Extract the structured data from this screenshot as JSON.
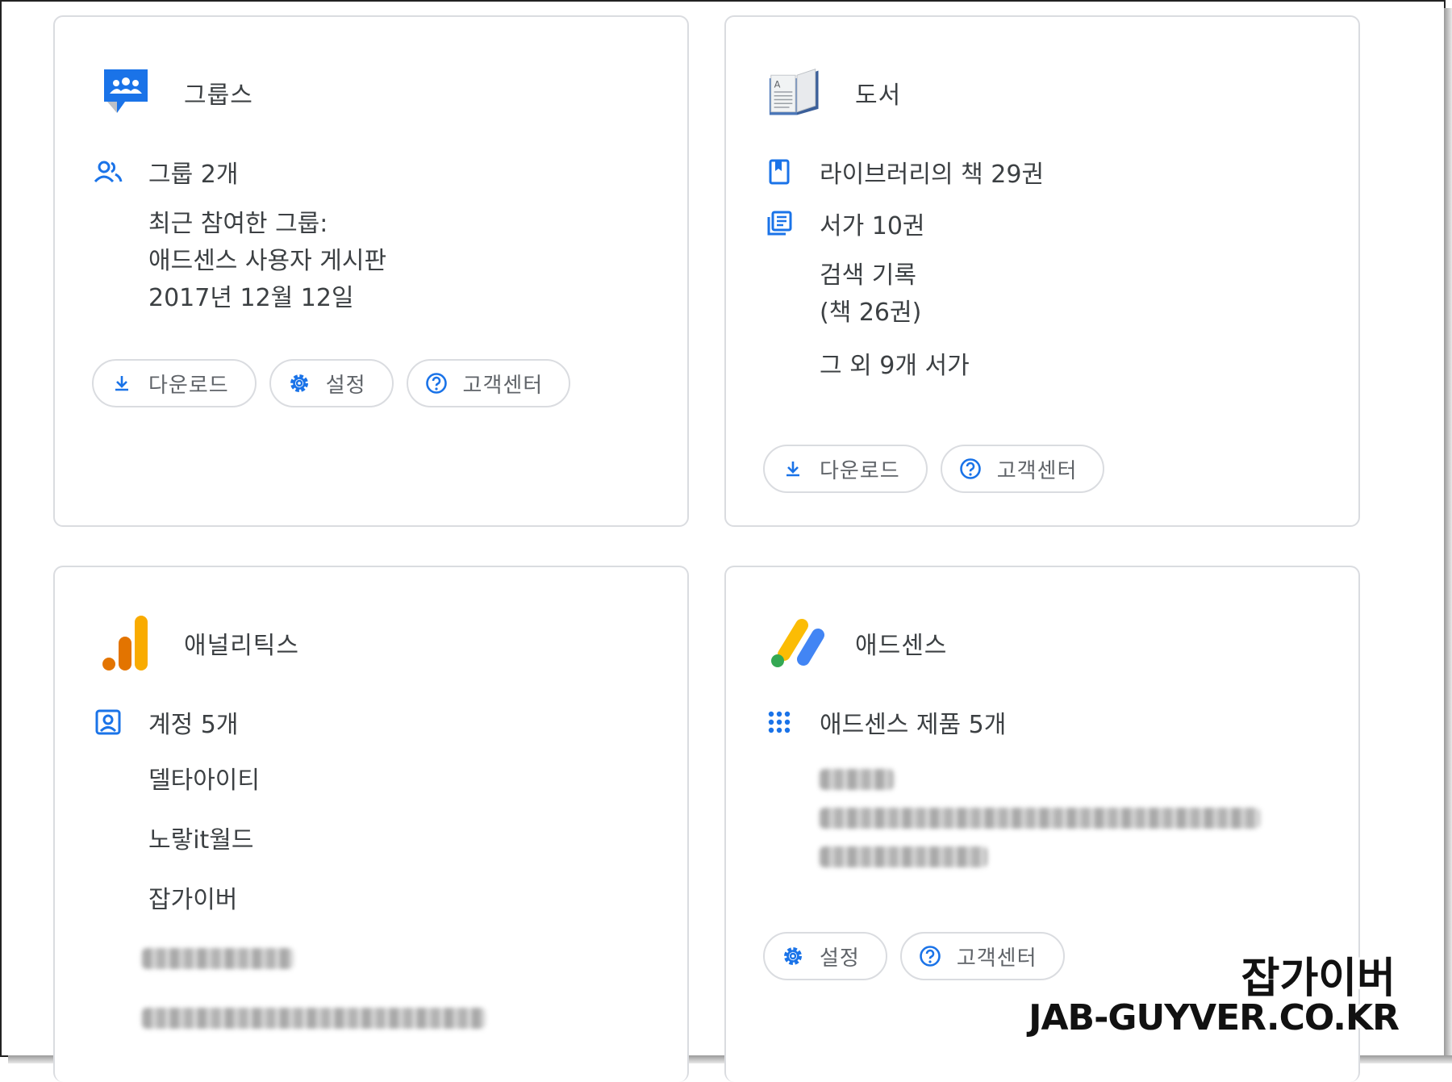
{
  "colors": {
    "accent_blue": "#1a73e8",
    "text": "#3c4043",
    "muted": "#5f6368",
    "border": "#dadce0",
    "analytics_orange": "#f9ab00",
    "analytics_dark": "#e37400",
    "adsense_green": "#34a853",
    "adsense_yellow": "#fbbc04"
  },
  "groups": {
    "title": "그룹스",
    "count": "그룹 2개",
    "recent_label": "최근 참여한 그룹:",
    "recent_name": "애드센스 사용자 게시판",
    "recent_date": "2017년 12월 12일",
    "buttons": {
      "download": "다운로드",
      "settings": "설정",
      "help": "고객센터"
    }
  },
  "books": {
    "title": "도서",
    "library": "라이브러리의 책 29권",
    "shelves": "서가 10권",
    "history_label": "검색 기록",
    "history_count": "(책 26권)",
    "other": "그 외 9개 서가",
    "buttons": {
      "download": "다운로드",
      "help": "고객센터"
    }
  },
  "analytics": {
    "title": "애널리틱스",
    "accounts": "계정 5개",
    "items": [
      "델타아이티",
      "노랗it월드",
      "잡가이버"
    ]
  },
  "adsense": {
    "title": "애드센스",
    "products": "애드센스 제품 5개",
    "buttons": {
      "settings": "설정",
      "help": "고객센터"
    }
  },
  "watermark": {
    "name": "잡가이버",
    "site": "JAB-GUYVER.CO.KR"
  }
}
